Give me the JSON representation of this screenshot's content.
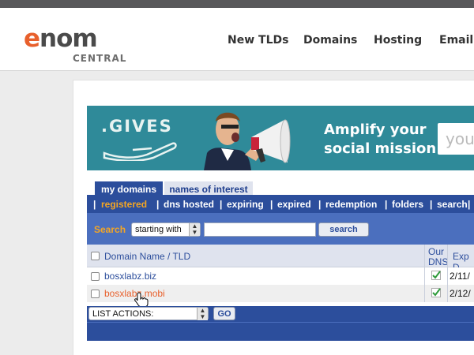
{
  "header": {
    "logo_text_first": "e",
    "logo_text_rest": "nom",
    "logo_sub": "CENTRAL",
    "nav": [
      "New TLDs",
      "Domains",
      "Hosting",
      "Email"
    ]
  },
  "banner": {
    "gives": ".GIVES",
    "tagline_line1": "Amplify your",
    "tagline_line2": "social mission.",
    "input_placeholder": "you"
  },
  "tabs": [
    "my domains",
    "names of interest"
  ],
  "subnav": {
    "items": [
      "registered",
      "dns hosted",
      "expiring",
      "expired",
      "redemption",
      "folders",
      "search"
    ],
    "selected": "registered"
  },
  "search": {
    "label": "Search",
    "mode_value": "starting with",
    "input_value": "",
    "button": "search"
  },
  "table": {
    "headers": {
      "domain": "Domain Name / TLD",
      "our_dns_line1": "Our",
      "our_dns_line2": "DNS",
      "exp": "Exp D"
    },
    "rows": [
      {
        "domain": "bosxlabz.biz",
        "our_dns": "check",
        "exp": "2/11/"
      },
      {
        "domain": "bosxlabz.mobi",
        "our_dns": "check",
        "exp": "2/12/"
      }
    ]
  },
  "actions": {
    "select_value": "LIST ACTIONS:",
    "go": "GO"
  },
  "colors": {
    "brand_orange": "#e8602c",
    "navy": "#2c4e9c",
    "search_blue": "#4b6fbe",
    "highlight": "#f5a623",
    "banner_teal": "#2f8a99"
  }
}
